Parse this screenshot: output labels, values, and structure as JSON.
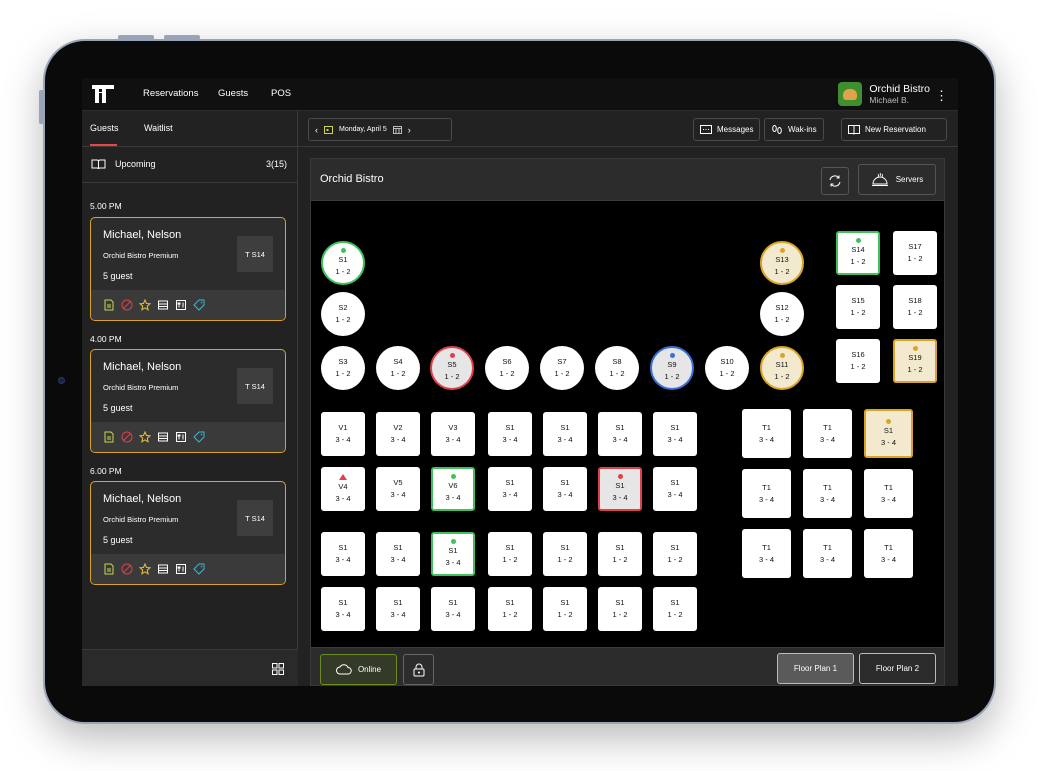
{
  "topbar": {
    "nav": [
      "Reservations",
      "Guests",
      "POS"
    ],
    "venue_name": "Orchid Bistro",
    "user_name": "Michael B.",
    "menu_icon": "kebab-menu-icon"
  },
  "left": {
    "tabs": [
      "Guests",
      "Waitlist"
    ],
    "upcoming_label": "Upcoming",
    "upcoming_count": "3(15)",
    "groups": [
      {
        "time": "5.00 PM",
        "name": "Michael, Nelson",
        "plan": "Orchid Bistro Premium",
        "guests": "5 guest",
        "table": "T S14"
      },
      {
        "time": "4.00 PM",
        "name": "Michael, Nelson",
        "plan": "Orchid Bistro Premium",
        "guests": "5 guest",
        "table": "T S14"
      },
      {
        "time": "6.00 PM",
        "name": "Michael, Nelson",
        "plan": "Orchid Bistro Premium",
        "guests": "5 guest",
        "table": "T S14"
      }
    ],
    "card_icons": [
      "note-icon",
      "cancel-icon",
      "star-icon",
      "list-icon",
      "menu-icon",
      "tag-icon"
    ]
  },
  "toolbar": {
    "date": "Monday, April 5",
    "messages": "Messages",
    "walkins": "Wak-ins",
    "new_reservation": "New Reservation"
  },
  "floor": {
    "title": "Orchid Bistro",
    "servers": "Servers",
    "online": "Online",
    "floor_plan_1": "Floor Plan 1",
    "floor_plan_2": "Floor Plan 2"
  },
  "colors": {
    "accent_gold": "#d9a524",
    "green": "#3dc25e",
    "red": "#e0404a",
    "blue": "#3a6fd8"
  },
  "tables": [
    {
      "id": "S1",
      "cap": "1 - 2",
      "shape": "round",
      "status": "green"
    },
    {
      "id": "S2",
      "cap": "1 - 2",
      "shape": "round",
      "status": ""
    },
    {
      "id": "S3",
      "cap": "1 - 2",
      "shape": "round",
      "status": ""
    },
    {
      "id": "S4",
      "cap": "1 - 2",
      "shape": "round",
      "status": ""
    },
    {
      "id": "S5",
      "cap": "1 - 2",
      "shape": "round",
      "status": "red"
    },
    {
      "id": "S6",
      "cap": "1 - 2",
      "shape": "round",
      "status": ""
    },
    {
      "id": "S7",
      "cap": "1 - 2",
      "shape": "round",
      "status": ""
    },
    {
      "id": "S8",
      "cap": "1 - 2",
      "shape": "round",
      "status": ""
    },
    {
      "id": "S9",
      "cap": "1 - 2",
      "shape": "round",
      "status": "blue"
    },
    {
      "id": "S10",
      "cap": "1 - 2",
      "shape": "round",
      "status": ""
    },
    {
      "id": "S11",
      "cap": "1 - 2",
      "shape": "round",
      "status": "gold"
    },
    {
      "id": "S12",
      "cap": "1 - 2",
      "shape": "round",
      "status": ""
    },
    {
      "id": "S13",
      "cap": "1 - 2",
      "shape": "round",
      "status": "gold"
    },
    {
      "id": "S14",
      "cap": "1 - 2",
      "shape": "square",
      "status": "green"
    },
    {
      "id": "S15",
      "cap": "1 - 2",
      "shape": "square",
      "status": ""
    },
    {
      "id": "S16",
      "cap": "1 - 2",
      "shape": "square",
      "status": ""
    },
    {
      "id": "S17",
      "cap": "1 - 2",
      "shape": "square",
      "status": ""
    },
    {
      "id": "S18",
      "cap": "1 - 2",
      "shape": "square",
      "status": ""
    },
    {
      "id": "S19",
      "cap": "1 - 2",
      "shape": "square",
      "status": "gold"
    },
    {
      "id": "V1",
      "cap": "3 - 4",
      "shape": "square",
      "status": ""
    },
    {
      "id": "V2",
      "cap": "3 - 4",
      "shape": "square",
      "status": ""
    },
    {
      "id": "V3",
      "cap": "3 - 4",
      "shape": "square",
      "status": ""
    },
    {
      "id": "S1",
      "cap": "3 - 4",
      "shape": "square",
      "status": ""
    },
    {
      "id": "S1",
      "cap": "3 - 4",
      "shape": "square",
      "status": ""
    },
    {
      "id": "S1",
      "cap": "3 - 4",
      "shape": "square",
      "status": ""
    },
    {
      "id": "S1",
      "cap": "3 - 4",
      "shape": "square",
      "status": ""
    },
    {
      "id": "V4",
      "cap": "3 - 4",
      "shape": "square",
      "status": "red-triangle"
    },
    {
      "id": "V5",
      "cap": "3 - 4",
      "shape": "square",
      "status": ""
    },
    {
      "id": "V6",
      "cap": "3 - 4",
      "shape": "square",
      "status": "green"
    },
    {
      "id": "S1",
      "cap": "3 - 4",
      "shape": "square",
      "status": ""
    },
    {
      "id": "S1",
      "cap": "3 - 4",
      "shape": "square",
      "status": ""
    },
    {
      "id": "S1",
      "cap": "3 - 4",
      "shape": "square",
      "status": "red"
    },
    {
      "id": "S1",
      "cap": "3 - 4",
      "shape": "square",
      "status": ""
    },
    {
      "id": "S1",
      "cap": "3 - 4",
      "shape": "square",
      "status": ""
    },
    {
      "id": "S1",
      "cap": "3 - 4",
      "shape": "square",
      "status": ""
    },
    {
      "id": "S1",
      "cap": "3 - 4",
      "shape": "square",
      "status": "green"
    },
    {
      "id": "S1",
      "cap": "1 - 2",
      "shape": "square",
      "status": ""
    },
    {
      "id": "S1",
      "cap": "1 - 2",
      "shape": "square",
      "status": ""
    },
    {
      "id": "S1",
      "cap": "1 - 2",
      "shape": "square",
      "status": ""
    },
    {
      "id": "S1",
      "cap": "1 - 2",
      "shape": "square",
      "status": ""
    },
    {
      "id": "S1",
      "cap": "3 - 4",
      "shape": "square",
      "status": ""
    },
    {
      "id": "S1",
      "cap": "3 - 4",
      "shape": "square",
      "status": ""
    },
    {
      "id": "S1",
      "cap": "3 - 4",
      "shape": "square",
      "status": ""
    },
    {
      "id": "S1",
      "cap": "1 - 2",
      "shape": "square",
      "status": ""
    },
    {
      "id": "S1",
      "cap": "1 - 2",
      "shape": "square",
      "status": ""
    },
    {
      "id": "S1",
      "cap": "1 - 2",
      "shape": "square",
      "status": ""
    },
    {
      "id": "S1",
      "cap": "1 - 2",
      "shape": "square",
      "status": ""
    },
    {
      "id": "T1",
      "cap": "3 - 4",
      "shape": "square",
      "status": ""
    },
    {
      "id": "T1",
      "cap": "3 - 4",
      "shape": "square",
      "status": ""
    },
    {
      "id": "S1",
      "cap": "3 - 4",
      "shape": "square",
      "status": "gold"
    },
    {
      "id": "T1",
      "cap": "3 - 4",
      "shape": "square",
      "status": ""
    },
    {
      "id": "T1",
      "cap": "3 - 4",
      "shape": "square",
      "status": ""
    },
    {
      "id": "T1",
      "cap": "3 - 4",
      "shape": "square",
      "status": ""
    },
    {
      "id": "T1",
      "cap": "3 - 4",
      "shape": "square",
      "status": ""
    },
    {
      "id": "T1",
      "cap": "3 - 4",
      "shape": "square",
      "status": ""
    },
    {
      "id": "T1",
      "cap": "3 - 4",
      "shape": "square",
      "status": ""
    }
  ]
}
